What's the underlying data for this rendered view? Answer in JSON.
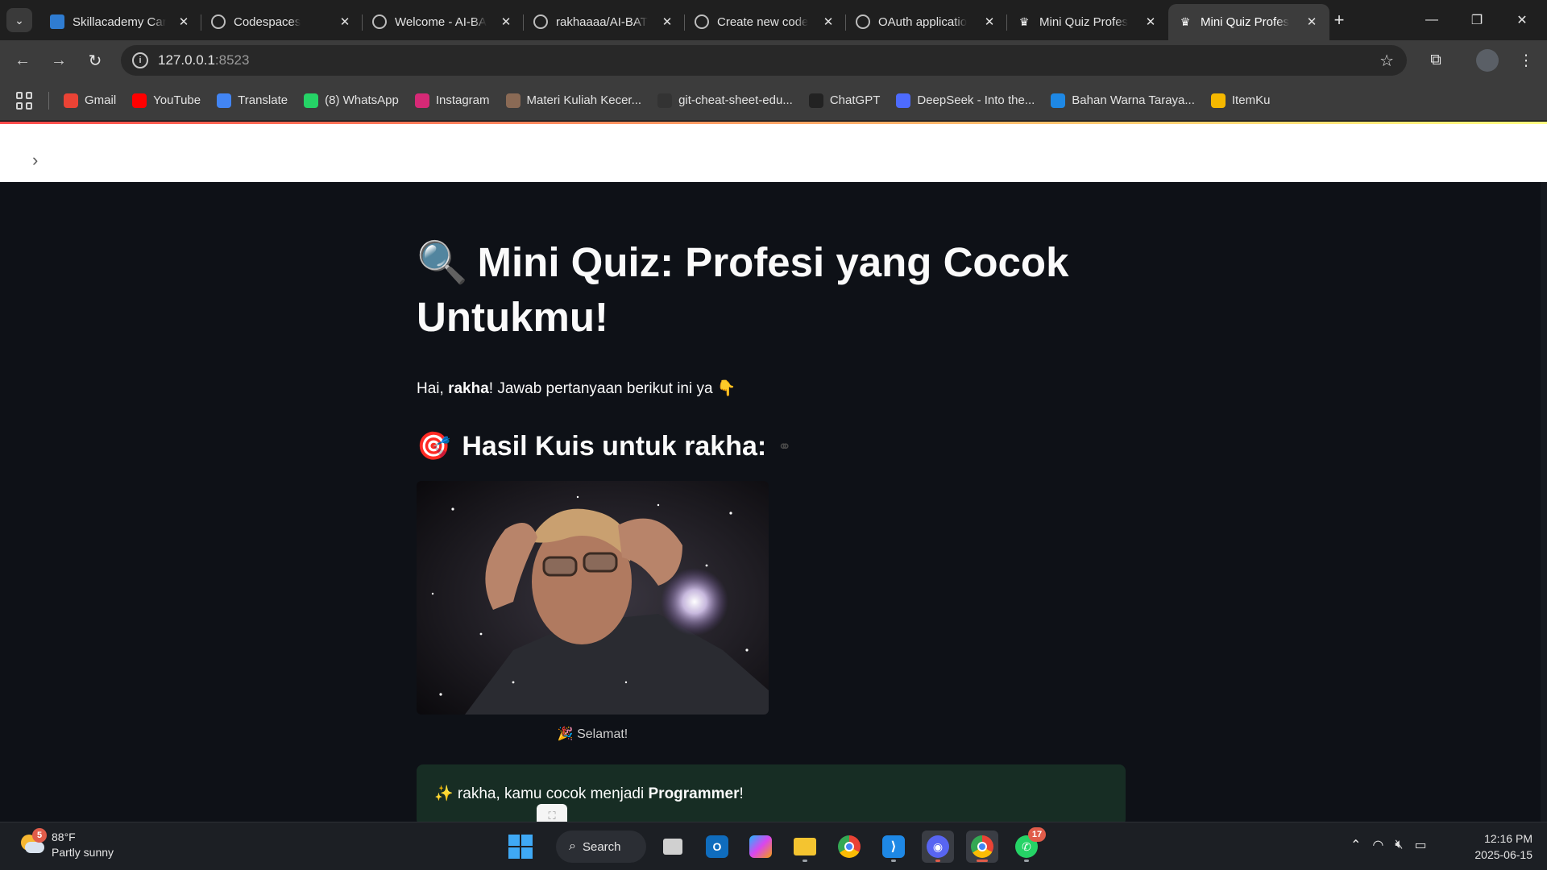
{
  "browser": {
    "tabs": [
      {
        "title": "Skillacademy Car",
        "icon": "skillacademy-icon"
      },
      {
        "title": "Codespaces",
        "icon": "github-icon"
      },
      {
        "title": "Welcome - AI-BA",
        "icon": "github-icon"
      },
      {
        "title": "rakhaaaa/AI-BAT",
        "icon": "github-icon"
      },
      {
        "title": "Create new code",
        "icon": "github-icon"
      },
      {
        "title": "OAuth applicatio",
        "icon": "github-icon"
      },
      {
        "title": "Mini Quiz Profes",
        "icon": "streamlit-crown-icon"
      },
      {
        "title": "Mini Quiz Profes",
        "icon": "streamlit-crown-icon",
        "active": true
      }
    ],
    "url_host": "127.0.0.1",
    "url_port": ":8523",
    "bookmarks": [
      {
        "label": "Gmail",
        "icon": "gmail-icon",
        "color": "#ea4335"
      },
      {
        "label": "YouTube",
        "icon": "youtube-icon",
        "color": "#ff0000"
      },
      {
        "label": "Translate",
        "icon": "translate-icon",
        "color": "#4285f4"
      },
      {
        "label": "(8) WhatsApp",
        "icon": "whatsapp-icon",
        "color": "#25d366"
      },
      {
        "label": "Instagram",
        "icon": "instagram-icon",
        "color": "#d62976"
      },
      {
        "label": "Materi Kuliah Kecer...",
        "icon": "avatar-icon",
        "color": "#8a6a55"
      },
      {
        "label": "git-cheat-sheet-edu...",
        "icon": "github-icon",
        "color": "#333333"
      },
      {
        "label": "ChatGPT",
        "icon": "chatgpt-icon",
        "color": "#222222"
      },
      {
        "label": "DeepSeek - Into the...",
        "icon": "deepseek-icon",
        "color": "#4d6bfe"
      },
      {
        "label": "Bahan Warna Taraya...",
        "icon": "canva-icon",
        "color": "#1e88e5"
      },
      {
        "label": "ItemKu",
        "icon": "itemku-icon",
        "color": "#f5b800"
      }
    ]
  },
  "page": {
    "title_emoji": "🔍",
    "title": "Mini Quiz: Profesi yang Cocok Untukmu!",
    "greeting_prefix": "Hai, ",
    "greeting_name": "rakha",
    "greeting_suffix": "! Jawab pertanyaan berikut ini ya 👇",
    "result_emoji": "🎯",
    "result_heading": "Hasil Kuis untuk rakha:",
    "anchor_symbol": "⚭",
    "image_caption": "🎉 Selamat!",
    "result_prefix": "✨ rakha, kamu cocok menjadi ",
    "result_profession": "Programmer",
    "result_suffix": "!"
  },
  "taskbar": {
    "weather_temp": "88°F",
    "weather_desc": "Partly sunny",
    "weather_badge": "5",
    "search_label": "Search",
    "whatsapp_badge": "17",
    "time": "12:16 PM",
    "date": "2025-06-15"
  }
}
